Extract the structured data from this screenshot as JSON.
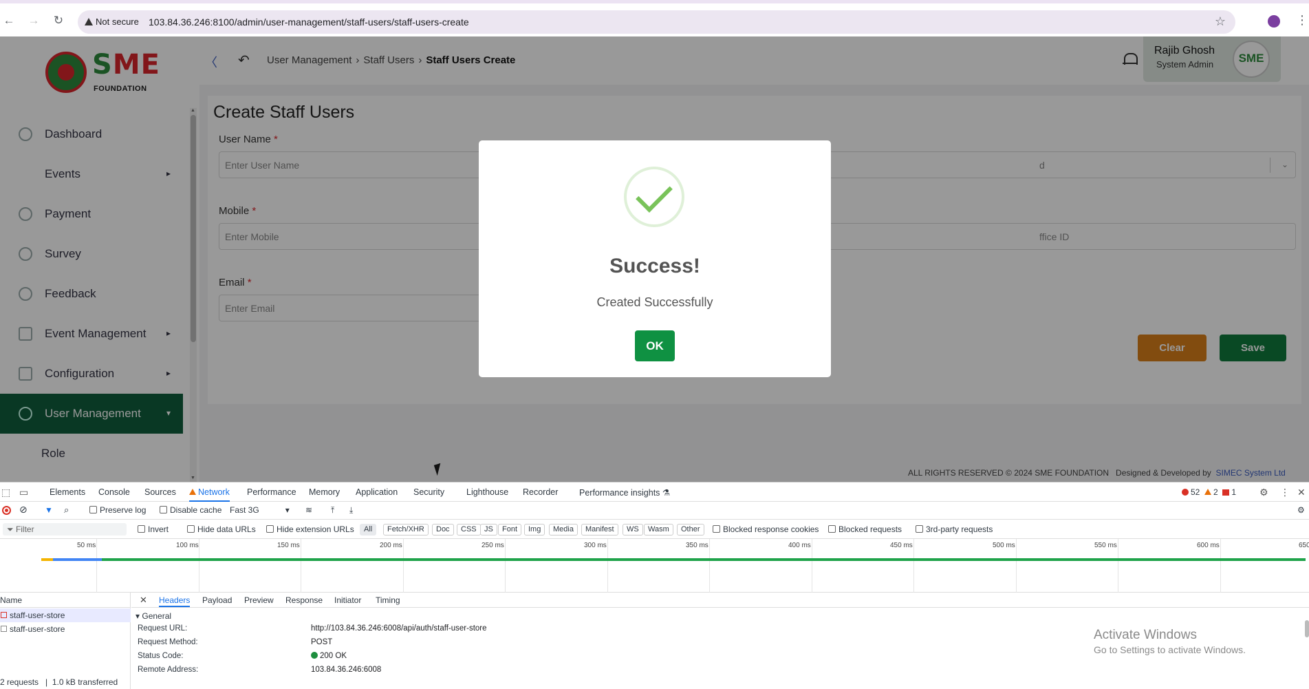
{
  "browser": {
    "security_label": "Not secure",
    "url": "103.84.36.246:8100/admin/user-management/staff-users/staff-users-create"
  },
  "brand": {
    "logo_word_s": "S",
    "logo_word_me": "ME",
    "logo_sub": "FOUNDATION"
  },
  "sidebar": {
    "items": [
      {
        "label": "Dashboard"
      },
      {
        "label": "Events"
      },
      {
        "label": "Payment"
      },
      {
        "label": "Survey"
      },
      {
        "label": "Feedback"
      },
      {
        "label": "Event Management"
      },
      {
        "label": "Configuration"
      },
      {
        "label": "User Management"
      },
      {
        "label": "Role"
      }
    ]
  },
  "header": {
    "breadcrumb": [
      "User Management",
      "Staff Users",
      "Staff Users Create"
    ],
    "user_name": "Rajib Ghosh",
    "user_role": "System Admin",
    "avatar_text": "SME"
  },
  "form": {
    "title": "Create Staff Users",
    "user_name_label": "User Name",
    "user_name_placeholder": "Enter User Name",
    "mobile_label": "Mobile",
    "mobile_placeholder": "Enter Mobile",
    "email_label": "Email",
    "email_placeholder": "Enter Email",
    "right_select_partial": "d",
    "office_id_partial": "ffice ID",
    "required_mark": "*",
    "clear_label": "Clear",
    "save_label": "Save"
  },
  "footer": {
    "rights": "ALL RIGHTS RESERVED © 2024 SME FOUNDATION",
    "designed_by": "Designed & Developed by",
    "developer": "SIMEC System Ltd"
  },
  "modal": {
    "title": "Success!",
    "message": "Created Successfully",
    "ok_label": "OK"
  },
  "devtools": {
    "tabs": [
      "Elements",
      "Console",
      "Sources",
      "Network",
      "Performance",
      "Memory",
      "Application",
      "Security",
      "Lighthouse",
      "Recorder",
      "Performance insights"
    ],
    "active_tab": "Network",
    "errors": "52",
    "warnings": "2",
    "issues": "1",
    "preserve_log": "Preserve log",
    "disable_cache": "Disable cache",
    "throttle": "Fast 3G",
    "filter_placeholder": "Filter",
    "invert": "Invert",
    "hide_data_urls": "Hide data URLs",
    "hide_extension_urls": "Hide extension URLs",
    "type_chips": [
      "All",
      "Fetch/XHR",
      "Doc",
      "CSS",
      "JS",
      "Font",
      "Img",
      "Media",
      "Manifest",
      "WS",
      "Wasm",
      "Other"
    ],
    "blocked_response_cookies": "Blocked response cookies",
    "blocked_requests": "Blocked requests",
    "third_party": "3rd-party requests",
    "timeline_ticks": [
      "50 ms",
      "100 ms",
      "150 ms",
      "200 ms",
      "250 ms",
      "300 ms",
      "350 ms",
      "400 ms",
      "450 ms",
      "500 ms",
      "550 ms",
      "600 ms",
      "650"
    ],
    "name_header": "Name",
    "requests": [
      "staff-user-store",
      "staff-user-store"
    ],
    "summary_requests": "2 requests",
    "summary_transferred": "1.0 kB transferred",
    "detail_tabs": [
      "Headers",
      "Payload",
      "Preview",
      "Response",
      "Initiator",
      "Timing"
    ],
    "general_label": "General",
    "headers": [
      {
        "key": "Request URL:",
        "value": "http://103.84.36.246:6008/api/auth/staff-user-store"
      },
      {
        "key": "Request Method:",
        "value": "POST"
      },
      {
        "key": "Status Code:",
        "value": "200 OK"
      },
      {
        "key": "Remote Address:",
        "value": "103.84.36.246:6008"
      }
    ]
  },
  "watermark": {
    "line1": "Activate Windows",
    "line2": "Go to Settings to activate Windows."
  }
}
